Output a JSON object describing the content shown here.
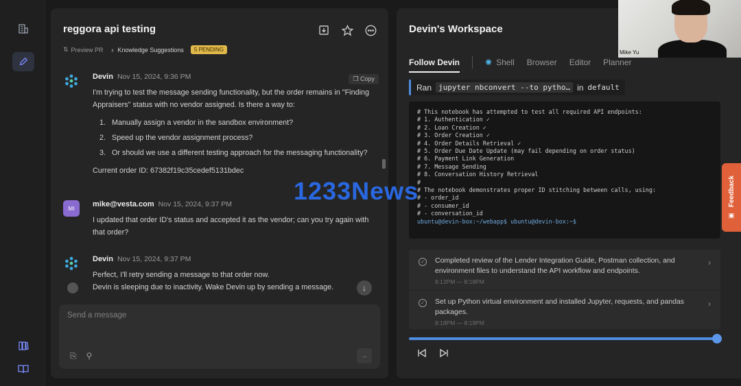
{
  "rail": {
    "icons": [
      "building-icon",
      "edit-icon",
      "books-icon",
      "book-icon"
    ]
  },
  "chat": {
    "title": "reggora api testing",
    "preview_pr": "Preview PR",
    "knowledge_suggestions": "Knowledge Suggestions",
    "pending_badge": "5 PENDING",
    "messages": [
      {
        "author": "Devin",
        "time": "Nov 15, 2024, 9:36 PM",
        "copy_label": "Copy",
        "intro": "I'm trying to test the message sending functionality, but the order remains in \"Finding Appraisers\" status with no vendor assigned. Is there a way to:",
        "items": [
          "Manually assign a vendor in the sandbox environment?",
          "Speed up the vendor assignment process?",
          "Or should we use a different testing approach for the messaging functionality?"
        ],
        "footer": "Current order ID: 67382f19c35cedef5131bdec"
      },
      {
        "author": "mike@vesta.com",
        "avatar": "MI",
        "time": "Nov 15, 2024, 9:37 PM",
        "body": "I updated that order ID's status and accepted it as the vendor; can you try again with that order?"
      },
      {
        "author": "Devin",
        "time": "Nov 15, 2024, 9:37 PM",
        "body": "Perfect, I'll retry sending a message to that order now."
      }
    ],
    "sleep_notice": "Devin is sleeping due to inactivity. Wake Devin up by sending a message.",
    "compose_placeholder": "Send a message"
  },
  "workspace": {
    "title": "Devin's Workspace",
    "tabs": [
      "Follow Devin",
      "Shell",
      "Browser",
      "Editor",
      "Planner"
    ],
    "ran_label": "Ran",
    "ran_command": "jupyter nbconvert --to pytho…",
    "ran_in": "in",
    "ran_location": "default",
    "terminal_lines": [
      "# This notebook has attempted to test all required API endpoints:",
      "# 1. Authentication ✓",
      "# 2. Loan Creation ✓",
      "# 3. Order Creation ✓",
      "# 4. Order Details Retrieval ✓",
      "# 5. Order Due Date Update (may fail depending on order status)",
      "# 6. Payment Link Generation",
      "# 7. Message Sending",
      "# 8. Conversation History Retrieval",
      "#",
      "# The notebook demonstrates proper ID stitching between calls, using:",
      "# - order_id",
      "# - consumer_id",
      "# - conversation_id"
    ],
    "terminal_prompt": "ubuntu@devin-box:~/webapp$ ubuntu@devin-box:~$",
    "activity": [
      {
        "text": "Completed review of the Lender Integration Guide, Postman collection, and environment files to understand the API workflow and endpoints.",
        "time": "8:12PM — 8:18PM"
      },
      {
        "text": "Set up Python virtual environment and installed Jupyter, requests, and pandas packages.",
        "time": "8:18PM — 8:19PM"
      }
    ],
    "playback_progress": 0.99
  },
  "webcam": {
    "name": "Mike Yu"
  },
  "feedback_label": "Feedback",
  "watermark": "1233News"
}
